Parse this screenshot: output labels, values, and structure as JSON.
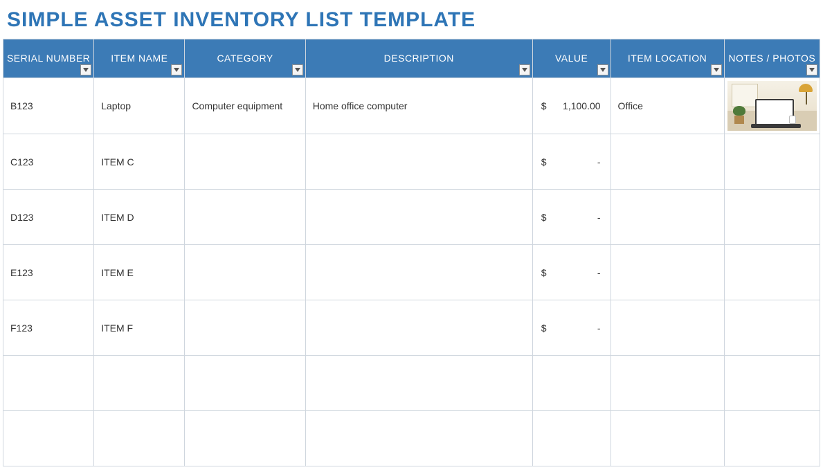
{
  "title": "SIMPLE ASSET INVENTORY LIST TEMPLATE",
  "currency": "$",
  "columns": [
    {
      "key": "serial",
      "label": "SERIAL NUMBER"
    },
    {
      "key": "item",
      "label": "ITEM NAME"
    },
    {
      "key": "category",
      "label": "CATEGORY"
    },
    {
      "key": "desc",
      "label": "DESCRIPTION"
    },
    {
      "key": "value",
      "label": "VALUE"
    },
    {
      "key": "location",
      "label": "ITEM LOCATION"
    },
    {
      "key": "notes",
      "label": "NOTES / PHOTOS"
    }
  ],
  "rows": [
    {
      "serial": "B123",
      "item": "Laptop",
      "category": "Computer equipment",
      "desc": "Home office computer",
      "value": "1,100.00",
      "location": "Office",
      "photo": true
    },
    {
      "serial": "C123",
      "item": "ITEM C",
      "category": "",
      "desc": "",
      "value": "-",
      "location": "",
      "photo": false
    },
    {
      "serial": "D123",
      "item": "ITEM D",
      "category": "",
      "desc": "",
      "value": "-",
      "location": "",
      "photo": false
    },
    {
      "serial": "E123",
      "item": "ITEM E",
      "category": "",
      "desc": "",
      "value": "-",
      "location": "",
      "photo": false
    },
    {
      "serial": "F123",
      "item": "ITEM F",
      "category": "",
      "desc": "",
      "value": "-",
      "location": "",
      "photo": false
    },
    {
      "serial": "",
      "item": "",
      "category": "",
      "desc": "",
      "value": "",
      "location": "",
      "photo": false
    },
    {
      "serial": "",
      "item": "",
      "category": "",
      "desc": "",
      "value": "",
      "location": "",
      "photo": false
    }
  ],
  "colors": {
    "header_bg": "#3c7bb6",
    "title": "#2e75b6",
    "border": "#cfd6de"
  }
}
